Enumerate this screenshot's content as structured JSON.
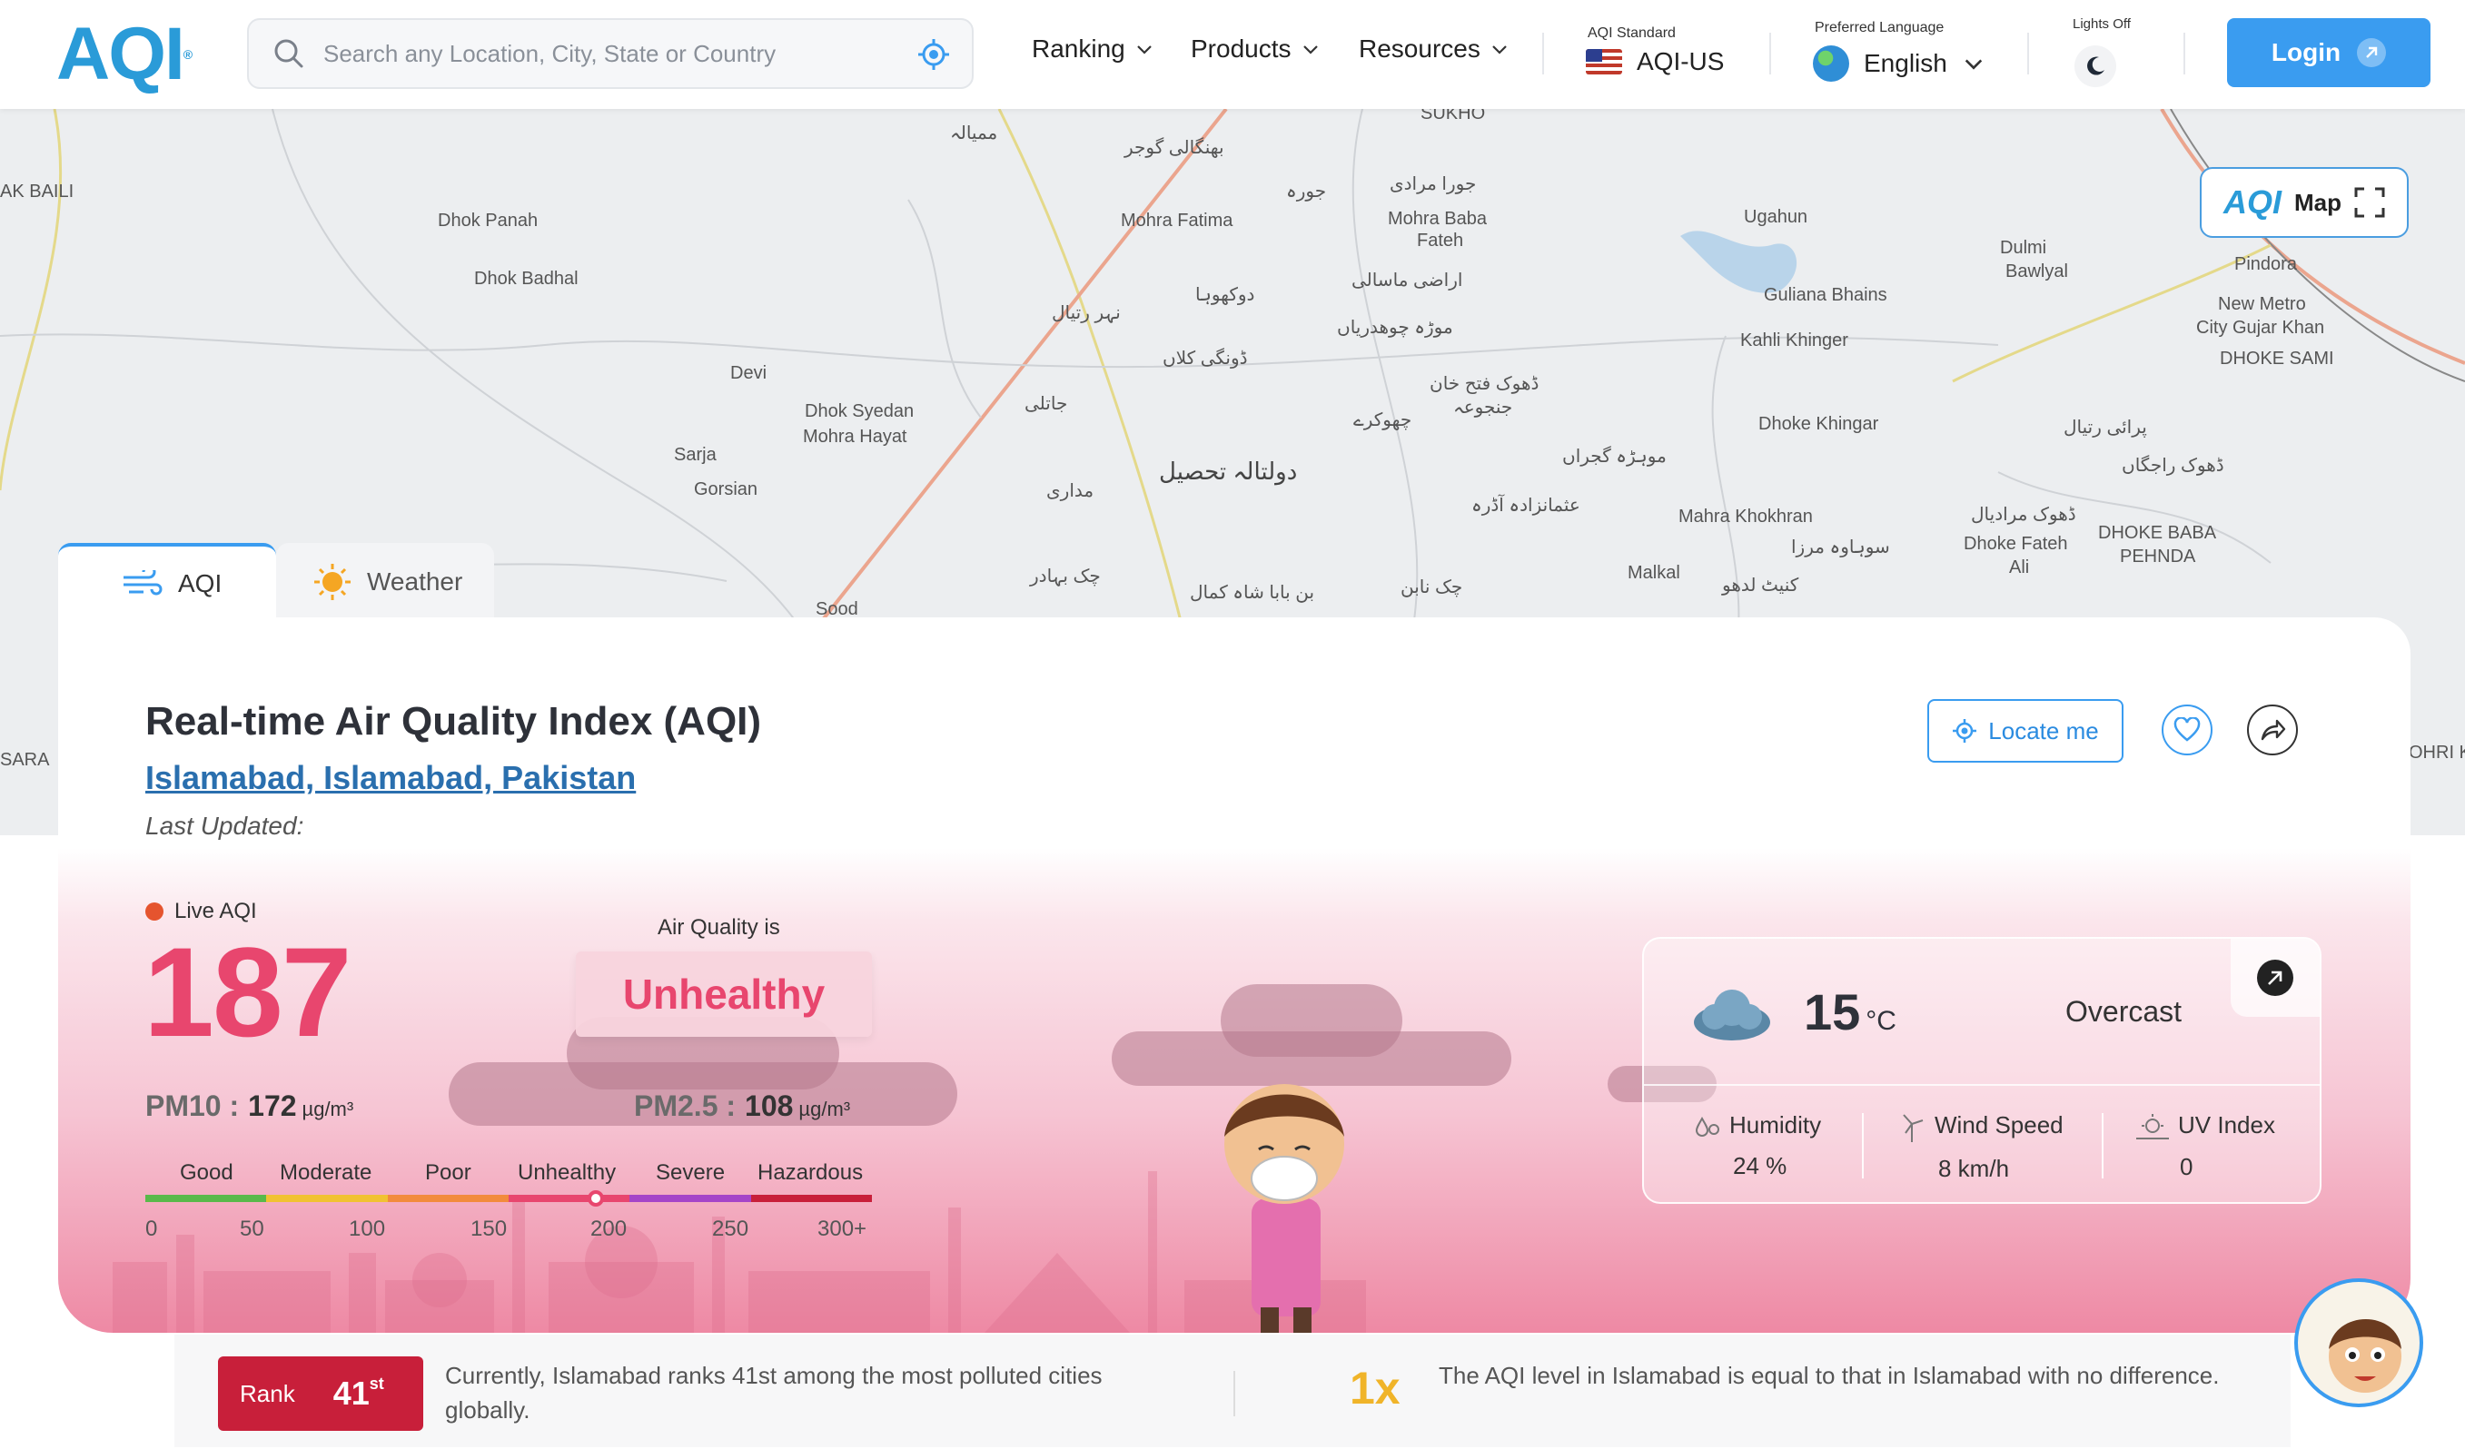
{
  "header": {
    "logo": "AQI",
    "search_placeholder": "Search any Location, City, State or Country",
    "nav": [
      {
        "label": "Ranking"
      },
      {
        "label": "Products"
      },
      {
        "label": "Resources"
      }
    ],
    "aqi_standard_label": "AQI Standard",
    "aqi_standard_value": "AQI-US",
    "language_label": "Preferred Language",
    "language_value": "English",
    "lights_label": "Lights Off",
    "login_label": "Login"
  },
  "map": {
    "button_label": "Map",
    "button_logo": "AQI",
    "places": [
      "SUKHO",
      "ممیالہ",
      "بھنگالی گوجر",
      "جورہ",
      "جورا مرادی",
      "Mohra Baba",
      "Fateh",
      "Ugahun",
      "Dulmi",
      "Pindora",
      "Bawlyal",
      "New Metro",
      "City Gujar Khan",
      "DHOKE SAMI",
      "AK BAILI",
      "Dhok Panah",
      "Dhok Badhal",
      "Mohra Fatima",
      "دوکھوہا",
      "نہر رتیال",
      "اراضی ماسالی",
      "موڑہ چوھدریاں",
      "Guliana Bhains",
      "Kahli Khinger",
      "ڈونگی کلاں",
      "ڈھوک فتح خان",
      "جنجوعہ",
      "Devi",
      "Dhok Syedan",
      "Mohra Hayat",
      "جاتلی",
      "چھوکرے",
      "Sarja",
      "Gorsian",
      "Dhoke Khingar",
      "پرائی رتیال",
      "دولتالہ تحصیل",
      "موہڑہ گجراں",
      "ڈھوک راجگاں",
      "مداری",
      "عثمانزادہ آڈرہ",
      "Mahra Khokhran",
      "ڈھوک مرادیال",
      "سوہاوہ مرزا",
      "Dhoke Fateh",
      "Ali",
      "DHOKE BABA",
      "PEHNDA",
      "چک بہادر",
      "بن بابا شاہ کمال",
      "چک نابن",
      "Malkal",
      "کنیٹ لدھو",
      "Sood",
      "SARA",
      "OHRI K"
    ]
  },
  "tabs": [
    {
      "label": "AQI"
    },
    {
      "label": "Weather"
    }
  ],
  "main": {
    "title": "Real-time Air Quality Index (AQI)",
    "location": "Islamabad, Islamabad, Pakistan",
    "last_updated": "Last Updated:",
    "locate_me": "Locate me",
    "live_label": "Live AQI",
    "aqi_value": "187",
    "air_quality_is": "Air Quality is",
    "status": "Unhealthy",
    "pm10_label": "PM10 :",
    "pm10_value": "172",
    "pm10_unit": "µg/m³",
    "pm25_label": "PM2.5 :",
    "pm25_value": "108",
    "pm25_unit": "µg/m³",
    "scale_labels": [
      "Good",
      "Moderate",
      "Poor",
      "Unhealthy",
      "Severe",
      "Hazardous"
    ],
    "scale_numbers": [
      "0",
      "50",
      "100",
      "150",
      "200",
      "250",
      "300+"
    ],
    "scale_colors": [
      "#59b94a",
      "#f1c232",
      "#f28b3c",
      "#e8466e",
      "#a545c8",
      "#c81f3a"
    ],
    "scale_fraction": 0.62
  },
  "weather": {
    "temp": "15",
    "temp_unit": "°C",
    "condition": "Overcast",
    "humidity_label": "Humidity",
    "humidity_value": "24 %",
    "wind_label": "Wind Speed",
    "wind_value": "8 km/h",
    "uv_label": "UV Index",
    "uv_value": "0"
  },
  "rank": {
    "label": "Rank",
    "number": "41",
    "suffix": "st",
    "text": "Currently, Islamabad ranks 41st among the most polluted cities globally.",
    "multiplier": "1x",
    "comparison": "The AQI level in Islamabad is equal to that in Islamabad with no difference."
  },
  "colors": {
    "accent": "#3a9cf0",
    "aqi_pink": "#e8466e",
    "rank_red": "#c81f3a",
    "mult_yellow": "#f0b429"
  }
}
